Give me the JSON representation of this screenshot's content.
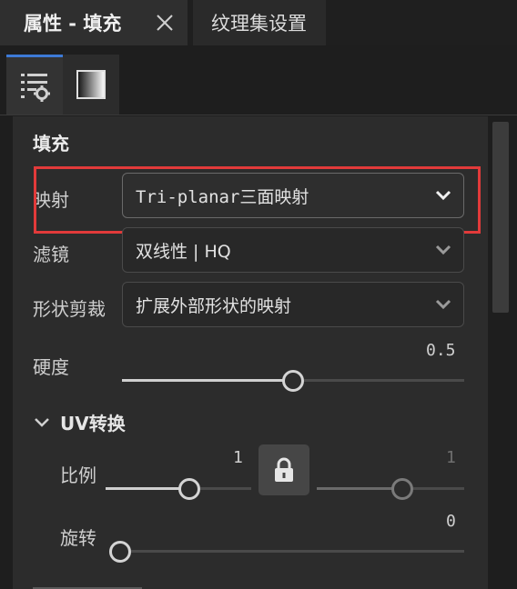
{
  "tabs": {
    "active_label": "属性 - 填充",
    "close_icon": "close-icon",
    "inactive_label": "纹理集设置"
  },
  "icon_tabs": [
    {
      "icon": "properties-settings-icon",
      "selected": true
    },
    {
      "icon": "gradient-fill-icon",
      "selected": false
    }
  ],
  "section": {
    "title": "填充"
  },
  "fields": {
    "mapping": {
      "label": "映射",
      "value": "Tri-planar三面映射"
    },
    "filter": {
      "label": "滤镜",
      "value": "双线性 | HQ"
    },
    "shape_crop": {
      "label": "形状剪裁",
      "value": "扩展外部形状的映射"
    },
    "hardness": {
      "label": "硬度",
      "value": "0.5",
      "fraction": 0.5
    }
  },
  "uv_transform": {
    "title": "UV转换",
    "scale": {
      "label": "比例",
      "value_left": "1",
      "value_right": "1",
      "fraction_left": 0.5,
      "fraction_right": 0.5,
      "locked": true
    },
    "rotation": {
      "label": "旋转",
      "value": "0",
      "fraction": 0.0
    }
  },
  "colors": {
    "accent_blue": "#3d7ad6",
    "highlight_red": "#e23a3a"
  }
}
